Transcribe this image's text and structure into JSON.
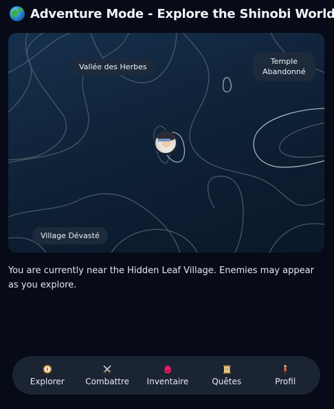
{
  "header": {
    "icon": "globe-icon",
    "title": "Adventure Mode - Explore the Shinobi World"
  },
  "map": {
    "locations": [
      {
        "name": "Vallée des Herbes"
      },
      {
        "name": "Temple\nAbandonné"
      },
      {
        "name": "Village Dévasté"
      }
    ],
    "player_avatar": "player-avatar"
  },
  "status_text": "You are currently near the Hidden Leaf Village. Enemies may appear as you explore.",
  "nav": {
    "items": [
      {
        "label": "Explorer",
        "icon": "compass-icon"
      },
      {
        "label": "Combattre",
        "icon": "crossed-swords-icon"
      },
      {
        "label": "Inventaire",
        "icon": "backpack-icon"
      },
      {
        "label": "Quêtes",
        "icon": "scroll-icon"
      },
      {
        "label": "Profil",
        "icon": "person-icon"
      }
    ]
  },
  "colors": {
    "background": "#070b17",
    "map_dark": "#0a1728",
    "map_light": "#16304d",
    "pill": "#1d2a3b",
    "nav_bar": "#1b2433",
    "contour": "#5b6572"
  }
}
